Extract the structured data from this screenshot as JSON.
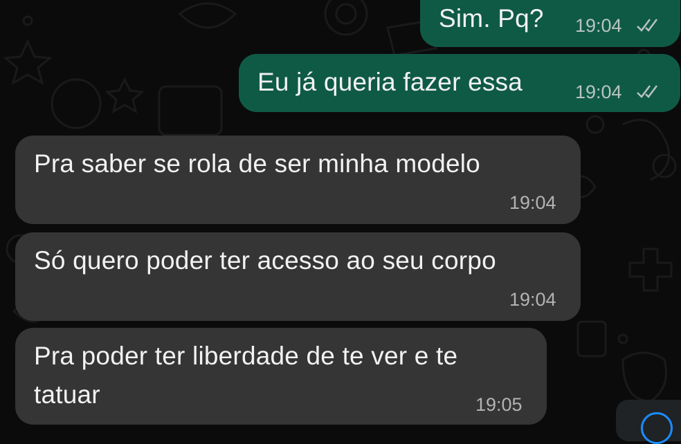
{
  "messages": [
    {
      "direction": "outgoing",
      "text": "Sim. Pq?",
      "time": "19:04",
      "status_icon": "read-double-check-icon"
    },
    {
      "direction": "outgoing",
      "text": "Eu já queria fazer essa",
      "time": "19:04",
      "status_icon": "read-double-check-icon"
    },
    {
      "direction": "incoming",
      "text": "Pra saber se rola de ser minha modelo",
      "time": "19:04"
    },
    {
      "direction": "incoming",
      "text": "Só quero poder ter acesso ao seu corpo",
      "time": "19:04"
    },
    {
      "direction": "incoming",
      "text_line1": "Pra poder ter liberdade de te ver e te",
      "text_line2": "tatuar",
      "time": "19:05"
    }
  ],
  "colors": {
    "background": "#0b0b0b",
    "outgoing_bubble": "#0f5a45",
    "incoming_bubble": "#353535",
    "text": "#f2f2f2",
    "timestamp": "#b3b3b3"
  },
  "scroll_button_icon": "scroll-to-bottom-icon"
}
